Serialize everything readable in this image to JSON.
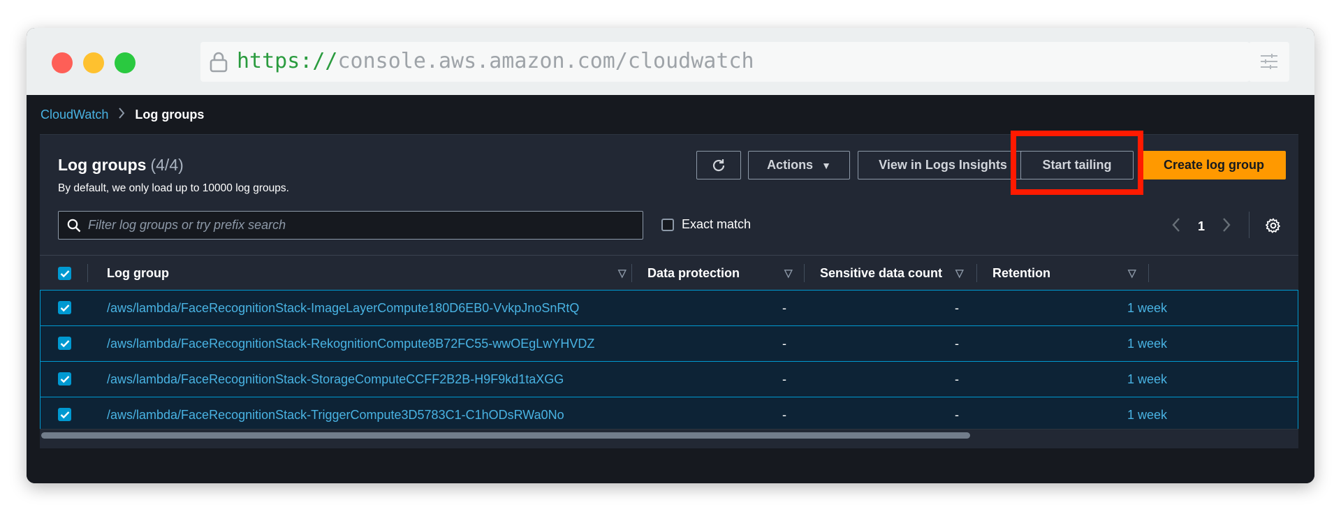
{
  "browser": {
    "url_scheme": "https://",
    "url_rest": "console.aws.amazon.com/cloudwatch"
  },
  "breadcrumb": {
    "root": "CloudWatch",
    "current": "Log groups"
  },
  "panel": {
    "title": "Log groups",
    "count": "(4/4)",
    "description": "By default, we only load up to 10000 log groups."
  },
  "toolbar": {
    "actions_label": "Actions",
    "insights_label": "View in Logs Insights",
    "tail_label": "Start tailing",
    "create_label": "Create log group"
  },
  "search": {
    "placeholder": "Filter log groups or try prefix search"
  },
  "exact_match": {
    "label": "Exact match",
    "checked": false
  },
  "pagination": {
    "page": "1"
  },
  "table": {
    "columns": [
      "Log group",
      "Data protection",
      "Sensitive data count",
      "Retention"
    ],
    "rows": [
      {
        "log_group": "/aws/lambda/FaceRecognitionStack-ImageLayerCompute180D6EB0-VvkpJnoSnRtQ",
        "data_protection": "-",
        "sensitive_count": "-",
        "retention": "1 week"
      },
      {
        "log_group": "/aws/lambda/FaceRecognitionStack-RekognitionCompute8B72FC55-wwOEgLwYHVDZ",
        "data_protection": "-",
        "sensitive_count": "-",
        "retention": "1 week"
      },
      {
        "log_group": "/aws/lambda/FaceRecognitionStack-StorageComputeCCFF2B2B-H9F9kd1taXGG",
        "data_protection": "-",
        "sensitive_count": "-",
        "retention": "1 week"
      },
      {
        "log_group": "/aws/lambda/FaceRecognitionStack-TriggerCompute3D5783C1-C1hODsRWa0No",
        "data_protection": "-",
        "sensitive_count": "-",
        "retention": "1 week"
      }
    ]
  },
  "colors": {
    "accent_orange": "#ff9900",
    "link_blue": "#49b3e3",
    "selection_blue": "#0099d1",
    "highlight_red": "#ff1a00"
  }
}
